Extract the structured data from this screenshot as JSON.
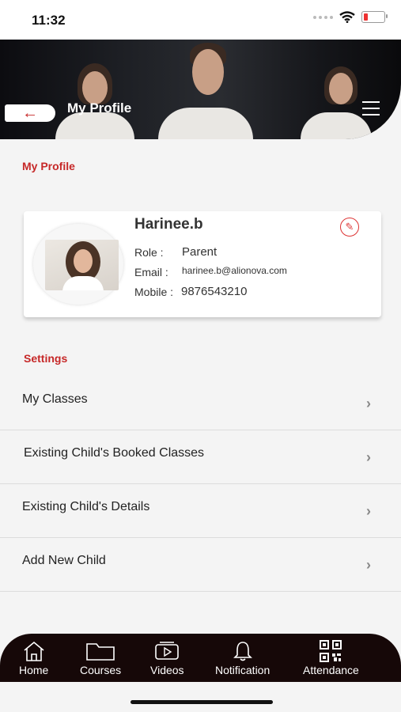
{
  "status": {
    "time": "11:32"
  },
  "header": {
    "title": "My Profile",
    "back_label": "←"
  },
  "profile": {
    "section_title": "My Profile",
    "name": "Harinee.b",
    "role_label": "Role :",
    "role": "Parent",
    "email_label": "Email :",
    "email": "harinee.b@alionova.com",
    "mobile_label": "Mobile :",
    "mobile": "9876543210"
  },
  "settings": {
    "title": "Settings",
    "items": [
      {
        "label": "My Classes"
      },
      {
        "label": "Existing Child's Booked Classes"
      },
      {
        "label": "Existing Child's Details"
      },
      {
        "label": "Add New Child"
      }
    ]
  },
  "tabs": [
    {
      "label": "Home",
      "icon": "home-icon"
    },
    {
      "label": "Courses",
      "icon": "folder-icon"
    },
    {
      "label": "Videos",
      "icon": "video-icon"
    },
    {
      "label": "Notification",
      "icon": "bell-icon"
    },
    {
      "label": "Attendance",
      "icon": "qr-code-icon"
    }
  ],
  "colors": {
    "accent": "#c62828",
    "tabbar": "#160808"
  }
}
